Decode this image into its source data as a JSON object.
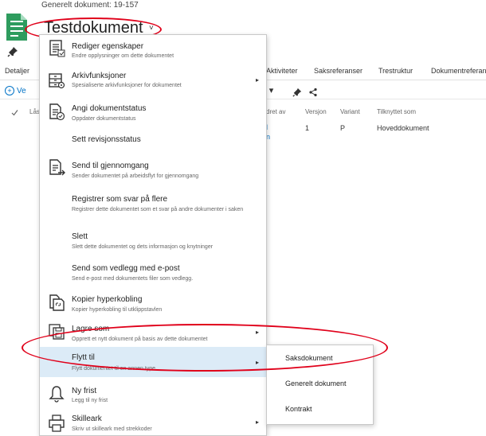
{
  "header": {
    "subtitle": "Generelt dokument: 19-157",
    "title": "Testdokument",
    "title_chevron": "˅"
  },
  "background": {
    "tabs": [
      "Detaljer",
      "Aktiviteter",
      "Saksreferanser",
      "Trestruktur",
      "Dokumentreferanser"
    ],
    "add_label": "Ve",
    "add_icon": "+",
    "tool_fragment": "r ▾",
    "columns": {
      "las": "Lås",
      "endret_av": "dret av",
      "versjon": "Versjon",
      "variant": "Variant",
      "tilknyttet": "Tilknyttet som"
    },
    "row": {
      "frag_a": "l",
      "frag_b": "n",
      "versjon": "1",
      "variant": "P",
      "tilknyttet": "Hoveddokument"
    }
  },
  "menu": {
    "items": [
      {
        "label": "Rediger egenskaper",
        "desc": "Endre opplysninger om dette dokumentet",
        "icon": "edit-properties-icon",
        "submenu": false
      },
      {
        "label": "Arkivfunksjoner",
        "desc": "Spesialiserte arkivfunksjoner for dokumentet",
        "icon": "archive-functions-icon",
        "submenu": true
      },
      {
        "label": "Angi dokumentstatus",
        "desc": "Oppdater dokumentstatus",
        "icon": "document-status-icon",
        "submenu": false
      },
      {
        "label": "Sett revisjonsstatus",
        "desc": "",
        "icon": "",
        "submenu": false
      },
      {
        "label": "Send til gjennomgang",
        "desc": "Sender dokumentet på arbeidsflyt for gjennomgang",
        "icon": "send-review-icon",
        "submenu": false
      },
      {
        "label": "Registrer som svar på flere",
        "desc": "Registrer dette dokumentet som et svar på andre dokumenter i saken",
        "icon": "",
        "submenu": false
      },
      {
        "label": "Slett",
        "desc": "Slett dette dokumentet og dets informasjon og knytninger",
        "icon": "",
        "submenu": false
      },
      {
        "label": "Send som vedlegg med e-post",
        "desc": "Send e-post med dokumentets filer som vedlegg.",
        "icon": "",
        "submenu": false
      },
      {
        "label": "Kopier hyperkobling",
        "desc": "Kopier hyperkobling til utklippstavlen",
        "icon": "copy-link-icon",
        "submenu": false
      },
      {
        "label": "Lagre som",
        "desc": "Opprett et nytt dokument på basis av dette dokumentet",
        "icon": "save-as-icon",
        "submenu": true
      },
      {
        "label": "Flytt til",
        "desc": "Flytt dokumentet til en annen type",
        "icon": "",
        "submenu": true
      },
      {
        "label": "Ny frist",
        "desc": "Legg til ny frist",
        "icon": "bell-icon",
        "submenu": false
      },
      {
        "label": "Skilleark",
        "desc": "Skriv ut skilleark med strekkoder",
        "icon": "printer-icon",
        "submenu": true
      }
    ],
    "arrow_glyph": "▸"
  },
  "submenu": {
    "items": [
      "Saksdokument",
      "Generelt dokument",
      "Kontrakt"
    ]
  },
  "colors": {
    "accent_green": "#2e9c5e",
    "link_blue": "#0072c6",
    "highlight": "#dcebf7",
    "annotation_red": "#e0001a"
  }
}
